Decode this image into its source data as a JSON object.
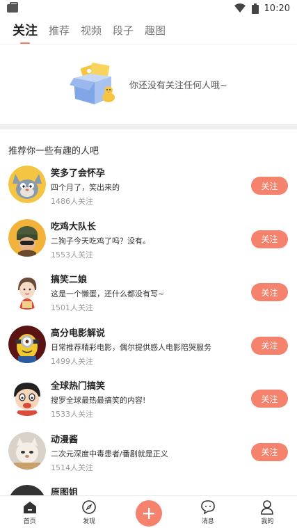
{
  "status_bar": {
    "time": "10:20"
  },
  "tabs": [
    {
      "label": "关注",
      "active": true
    },
    {
      "label": "推荐"
    },
    {
      "label": "视频"
    },
    {
      "label": "段子"
    },
    {
      "label": "趣图"
    }
  ],
  "empty_state": {
    "text": "你还没有关注任何人哦~"
  },
  "section_title": "推荐你一些有趣的人吧",
  "follow_label": "关注",
  "recommendations": [
    {
      "name": "笑多了会怀孕",
      "desc": "四个月了，笑出来的",
      "fans": "1486人关注",
      "avatar": "tom-cat"
    },
    {
      "name": "吃鸡大队长",
      "desc": "二狗子今天吃鸡了吗？没有。",
      "fans": "1553人关注",
      "avatar": "pubg-soldier"
    },
    {
      "name": "搞笑二娘",
      "desc": "这是一个懒蛋，还什么都没有写~",
      "fans": "1501人关注",
      "avatar": "cartoon-girl"
    },
    {
      "name": "高分电影解说",
      "desc": "日常推荐精彩电影，偶尔提供感人电影陪哭服务",
      "fans": "1499人关注",
      "avatar": "minion"
    },
    {
      "name": "全球热门搞笑",
      "desc": "搜罗全球最热最搞笑的内容!",
      "fans": "1533人关注",
      "avatar": "crayon-shin"
    },
    {
      "name": "动漫酱",
      "desc": "二次元深度中毒患者/番剧就是正义",
      "fans": "1514人关注",
      "avatar": "cat-cartoon"
    },
    {
      "name": "原图姐",
      "desc": "",
      "fans": "",
      "avatar": "partial"
    }
  ],
  "bottom_nav": [
    {
      "label": "首页",
      "icon": "home-icon"
    },
    {
      "label": "发现",
      "icon": "compass-icon"
    },
    {
      "label": "",
      "icon": "plus-icon"
    },
    {
      "label": "消息",
      "icon": "message-icon"
    },
    {
      "label": "我的",
      "icon": "user-icon"
    }
  ],
  "colors": {
    "accent": "#f5826d",
    "tab_indicator": "#f07a62"
  }
}
